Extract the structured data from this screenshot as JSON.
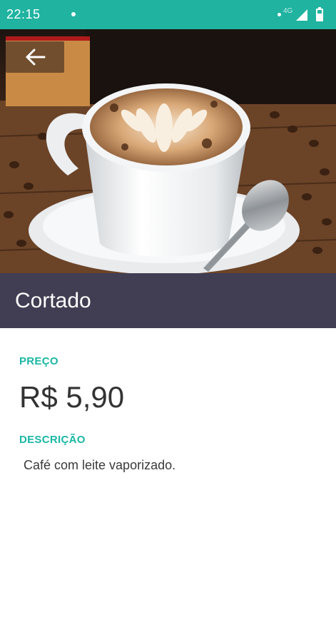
{
  "status_bar": {
    "time": "22:15",
    "network": "4G",
    "background_color": "#1fb3a0"
  },
  "header": {
    "back_icon": "arrow-left-icon",
    "image_subject": "cappuccino-cup-photo"
  },
  "product": {
    "name": "Cortado",
    "price_label": "PREÇO",
    "price": "R$ 5,90",
    "description_label": "DESCRIÇÃO",
    "description": "Café com leite vaporizado."
  },
  "colors": {
    "accent": "#19b7a6",
    "title_bar": "#413e53"
  }
}
